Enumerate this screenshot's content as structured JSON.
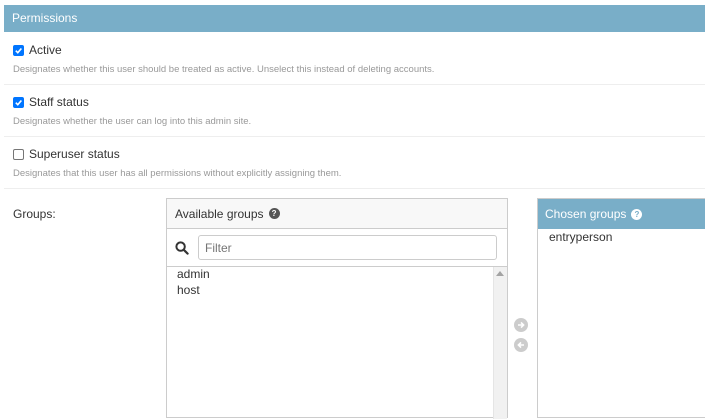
{
  "fieldset": {
    "title": "Permissions"
  },
  "permissions": [
    {
      "label": "Active",
      "checked": true,
      "help": "Designates whether this user should be treated as active. Unselect this instead of deleting accounts."
    },
    {
      "label": "Staff status",
      "checked": true,
      "help": "Designates whether the user can log into this admin site."
    },
    {
      "label": "Superuser status",
      "checked": false,
      "help": "Designates that this user has all permissions without explicitly assigning them."
    }
  ],
  "groups": {
    "label": "Groups:",
    "available": {
      "title": "Available groups",
      "help_icon": "question-icon",
      "filter_placeholder": "Filter",
      "filter_value": "",
      "items": [
        "admin",
        "host"
      ]
    },
    "chosen": {
      "title": "Chosen groups",
      "help_icon": "question-icon",
      "items": [
        "entryperson"
      ]
    },
    "chooser": {
      "add_icon": "arrow-right-circle-icon",
      "remove_icon": "arrow-left-circle-icon"
    }
  },
  "colors": {
    "header_bg": "#79aec8",
    "checkbox_checked": "#0075ff",
    "help_text": "#999999",
    "chooser_inactive": "#cccccc"
  }
}
